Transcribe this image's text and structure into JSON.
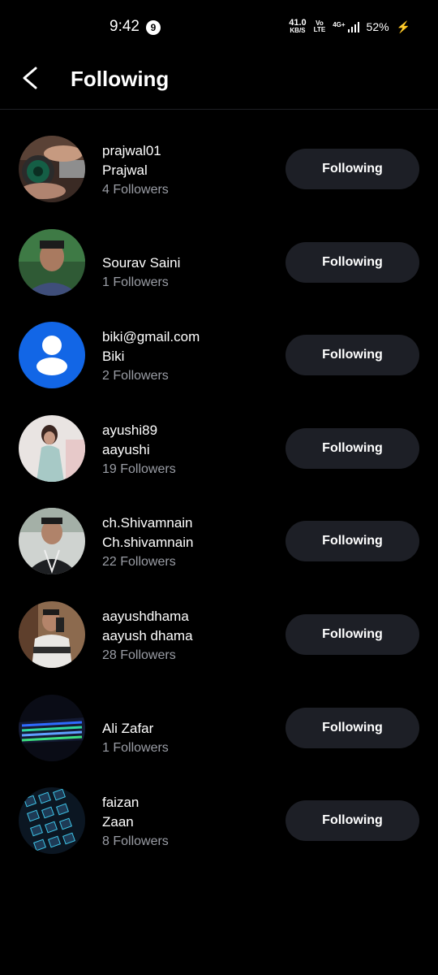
{
  "status_bar": {
    "time": "9:42",
    "notification_count": "9",
    "net_speed_value": "41.0",
    "net_speed_unit": "KB/S",
    "volte_top": "Vo",
    "volte_bottom": "LTE",
    "network_type": "4G+",
    "battery": "52%"
  },
  "header": {
    "title": "Following",
    "back_icon": "chevron-left-icon"
  },
  "users": [
    {
      "username": "prajwal01",
      "name": "Prajwal",
      "followers": "4 Followers",
      "button": "Following"
    },
    {
      "username": "Sourav Saini",
      "name": "",
      "followers": "1 Followers",
      "button": "Following"
    },
    {
      "username": "biki@gmail.com",
      "name": "Biki",
      "followers": "2 Followers",
      "button": "Following"
    },
    {
      "username": "ayushi89",
      "name": "aayushi",
      "followers": "19 Followers",
      "button": "Following"
    },
    {
      "username": "ch.Shivamnain",
      "name": "Ch.shivamnain",
      "followers": "22 Followers",
      "button": "Following"
    },
    {
      "username": "aayushdhama",
      "name": "aayush dhama",
      "followers": "28 Followers",
      "button": "Following"
    },
    {
      "username": "Ali Zafar",
      "name": "",
      "followers": "1 Followers",
      "button": "Following"
    },
    {
      "username": "faizan",
      "name": "Zaan",
      "followers": "8 Followers",
      "button": "Following"
    }
  ],
  "colors": {
    "background": "#000000",
    "button_bg": "#1d1f26",
    "secondary_text": "#9a9da5",
    "default_avatar": "#1266e6"
  }
}
